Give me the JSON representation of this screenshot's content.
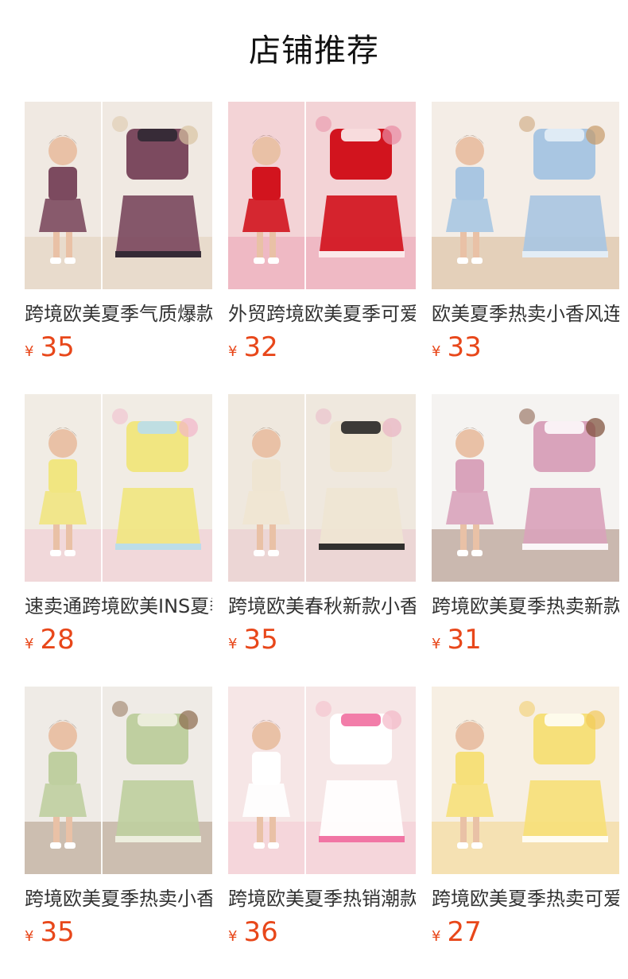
{
  "page": {
    "title": "店铺推荐",
    "currency_symbol": "¥"
  },
  "colors": {
    "price": "#e8471a",
    "text": "#333333",
    "title": "#111111",
    "background": "#ffffff"
  },
  "products": [
    {
      "name": "跨境欧美夏季气质爆款",
      "price": "35",
      "image": "girl-tweed-vest-skirt-set-photo",
      "palette": {
        "bg": "#f0e9e2",
        "main": "#7c4a5f",
        "accent": "#2c2630",
        "extra": "#d9c3a2"
      }
    },
    {
      "name": "外贸跨境欧美夏季可爱",
      "price": "32",
      "image": "girl-red-sequin-top-white-skirt-photo",
      "palette": {
        "bg": "#f3d3d6",
        "main": "#d2141e",
        "accent": "#ffffff",
        "extra": "#e88aa2"
      }
    },
    {
      "name": "欧美夏季热卖小香风连衣",
      "price": "33",
      "image": "girl-blue-plaid-set-photo",
      "palette": {
        "bg": "#f4ede6",
        "main": "#a9c6e2",
        "accent": "#e9f1f8",
        "extra": "#c69a68"
      }
    },
    {
      "name": "速卖通跨境欧美INS夏季",
      "price": "28",
      "image": "girl-yellow-blue-pink-halter-set-photo",
      "palette": {
        "bg": "#f1ece4",
        "main": "#f1e681",
        "accent": "#b6dcf3",
        "extra": "#f2b5c9"
      }
    },
    {
      "name": "跨境欧美春秋新款小香风",
      "price": "35",
      "image": "girl-cream-cardigan-bow-skirt-photo",
      "palette": {
        "bg": "#efe8de",
        "main": "#efe5d2",
        "accent": "#1c1c1c",
        "extra": "#e9b4c5"
      }
    },
    {
      "name": "跨境欧美夏季热卖新款",
      "price": "31",
      "image": "girl-pink-plaid-dress-photo",
      "palette": {
        "bg": "#f5f3f1",
        "main": "#d9a3bb",
        "accent": "#ffffff",
        "extra": "#7a4a34"
      }
    },
    {
      "name": "跨境欧美夏季热卖小香风",
      "price": "35",
      "image": "girl-green-houndstooth-vest-set-photo",
      "palette": {
        "bg": "#efebe6",
        "main": "#bfcfa0",
        "accent": "#f2f2e4",
        "extra": "#8c6a4b"
      }
    },
    {
      "name": "跨境欧美夏季热销潮款",
      "price": "36",
      "image": "white-butterfly-tee-pink-shorts-photo",
      "palette": {
        "bg": "#f6e6e6",
        "main": "#ffffff",
        "accent": "#f0669a",
        "extra": "#f4b7c6"
      }
    },
    {
      "name": "跨境欧美夏季热卖可爱",
      "price": "27",
      "image": "yellow-top-shorts-set-photo",
      "palette": {
        "bg": "#f7efe3",
        "main": "#f6e07a",
        "accent": "#ffffff",
        "extra": "#f2c95a"
      }
    }
  ]
}
